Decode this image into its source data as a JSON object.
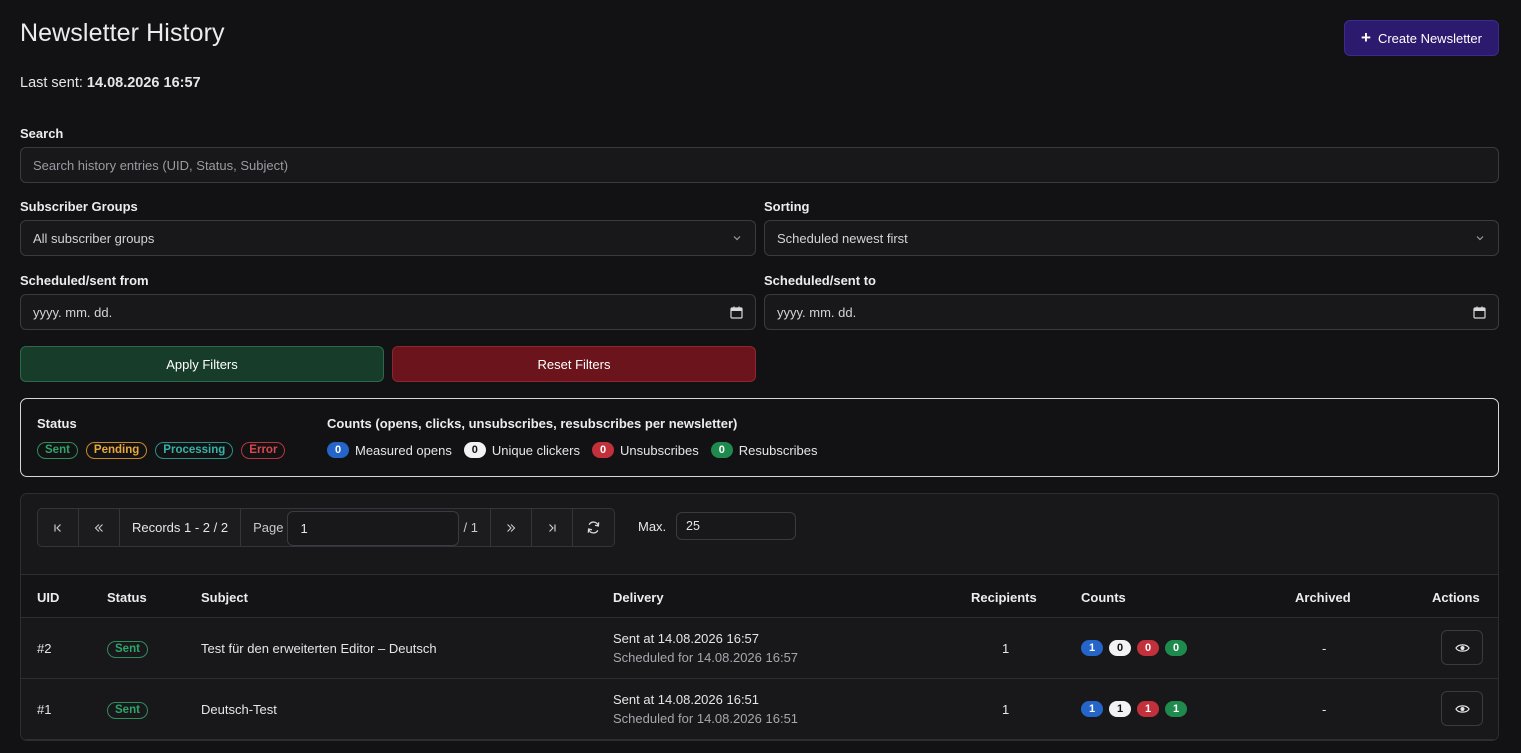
{
  "header": {
    "title": "Newsletter History",
    "create_label": "Create Newsletter",
    "last_sent_label": "Last sent:",
    "last_sent_value": "14.08.2026 16:57"
  },
  "filters": {
    "search_label": "Search",
    "search_placeholder": "Search history entries (UID, Status, Subject)",
    "groups_label": "Subscriber Groups",
    "groups_value": "All subscriber groups",
    "sorting_label": "Sorting",
    "sorting_value": "Scheduled newest first",
    "from_label": "Scheduled/sent from",
    "from_value": "yyyy. mm. dd.",
    "to_label": "Scheduled/sent to",
    "to_value": "yyyy. mm. dd.",
    "apply_label": "Apply Filters",
    "reset_label": "Reset Filters"
  },
  "legend": {
    "status_title": "Status",
    "statuses": [
      "Sent",
      "Pending",
      "Processing",
      "Error"
    ],
    "counts_title": "Counts (opens, clicks, unsubscribes, resubscribes per newsletter)",
    "counts": [
      {
        "value": "0",
        "label": "Measured opens",
        "color": "#2565c9"
      },
      {
        "value": "0",
        "label": "Unique clickers",
        "color": "#f2f2f4"
      },
      {
        "value": "0",
        "label": "Unsubscribes",
        "color": "#c2303b"
      },
      {
        "value": "0",
        "label": "Resubscribes",
        "color": "#1f8a4d"
      }
    ]
  },
  "pager": {
    "records": "Records 1 - 2 / 2",
    "page_label": "Page",
    "page_value": "1",
    "page_total": "/ 1",
    "max_label": "Max.",
    "max_value": "25"
  },
  "table": {
    "headers": {
      "uid": "UID",
      "status": "Status",
      "subject": "Subject",
      "delivery": "Delivery",
      "recipients": "Recipients",
      "counts": "Counts",
      "archived": "Archived",
      "actions": "Actions"
    },
    "rows": [
      {
        "uid": "#2",
        "status": "Sent",
        "subject": "Test für den erweiterten Editor – Deutsch",
        "sent_at": "Sent at 14.08.2026 16:57",
        "scheduled_for": "Scheduled for 14.08.2026 16:57",
        "recipients": "1",
        "counts": [
          "1",
          "0",
          "0",
          "0"
        ],
        "archived": "-"
      },
      {
        "uid": "#1",
        "status": "Sent",
        "subject": "Deutsch-Test",
        "sent_at": "Sent at 14.08.2026 16:51",
        "scheduled_for": "Scheduled for 14.08.2026 16:51",
        "recipients": "1",
        "counts": [
          "1",
          "1",
          "1",
          "1"
        ],
        "archived": "-"
      }
    ]
  }
}
